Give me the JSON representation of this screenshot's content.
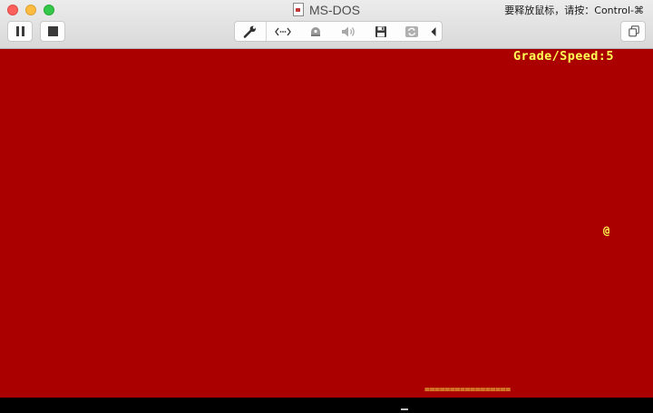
{
  "window": {
    "title": "MS-DOS",
    "mouse_release_hint": "要释放鼠标，请按：Control-⌘",
    "traffic_lights": [
      "close",
      "minimize",
      "maximize"
    ]
  },
  "toolbar": {
    "left_buttons": [
      {
        "name": "pause",
        "icon": "pause-icon"
      },
      {
        "name": "stop",
        "icon": "stop-icon"
      }
    ],
    "device_buttons": [
      {
        "name": "settings",
        "icon": "wrench-icon"
      },
      {
        "name": "network",
        "icon": "network-icon"
      },
      {
        "name": "disk",
        "icon": "hard-disk-icon"
      },
      {
        "name": "sound",
        "icon": "speaker-icon"
      },
      {
        "name": "floppy",
        "icon": "floppy-icon"
      },
      {
        "name": "shared-folder",
        "icon": "sync-icon"
      },
      {
        "name": "collapse",
        "icon": "chevron-left-icon"
      }
    ],
    "right_buttons": [
      {
        "name": "windows",
        "icon": "windows-icon"
      }
    ]
  },
  "screen": {
    "background_color": "#aa0000",
    "text_color": "#ffff55",
    "grade_speed_text": "Grade/Speed:5",
    "food_glyph": "@",
    "paddle_text": "================="
  }
}
